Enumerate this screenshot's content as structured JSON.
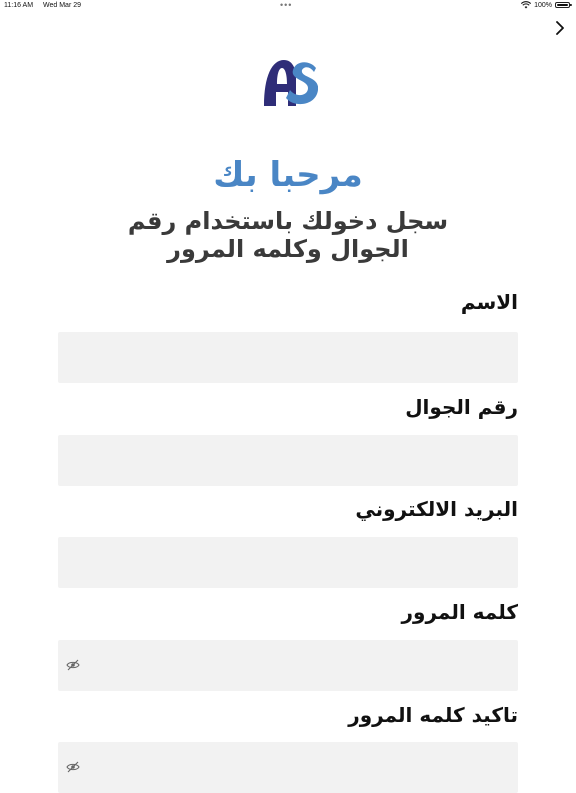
{
  "status_bar": {
    "time": "11:16 AM",
    "date": "Wed Mar 29",
    "battery": "100%",
    "battery_level": 1.0,
    "icons": [
      "wifi-icon",
      "battery-icon"
    ]
  },
  "nav": {
    "icon": "chevron-right-icon"
  },
  "logo": {
    "icon": "brand-logo-icon",
    "colors": {
      "dark": "#2f2d78",
      "light": "#4a86c5"
    }
  },
  "welcome": "مرحبا بك",
  "subtitle": "سجل دخولك باستخدام رقم الجوال وكلمه المرور",
  "form": {
    "fields": [
      {
        "label": "الاسم",
        "value": ""
      },
      {
        "label": "رقم الجوال",
        "value": ""
      },
      {
        "label": "البريد الالكتروني",
        "value": ""
      },
      {
        "label": "كلمه المرور",
        "value": "",
        "icon": "eye-off-icon"
      },
      {
        "label": "تاكيد كلمه المرور",
        "value": "",
        "icon": "eye-off-icon"
      }
    ]
  },
  "colors": {
    "accent": "#4a86c5",
    "input_bg": "#f2f2f2",
    "subtitle": "#3a3a3a"
  }
}
